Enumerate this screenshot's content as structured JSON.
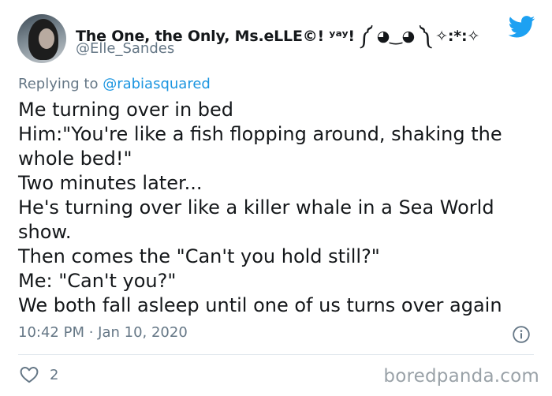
{
  "author": {
    "name": "The One, the Only, Ms.eLLE©! ʸᵃʸ! ༼ ◕‿◕ ༽ ✧:*:✧",
    "handle": "@Elle_Sandes"
  },
  "reply": {
    "prefix": "Replying to ",
    "mention": "@rabiasquared"
  },
  "body_lines": [
    "Me turning over in bed",
    "Him:\"You're like a fish flopping around, shaking the",
    "whole bed!\"",
    "Two minutes later...",
    "He's turning over like a killer whale in a Sea World",
    "show.",
    "Then comes the \"Can't you hold still?\"",
    "Me: \"Can't you?\"",
    "We both fall asleep until one of us turns over again"
  ],
  "timestamp": "10:42 PM · Jan 10, 2020",
  "likes": {
    "count": "2"
  },
  "watermark": "boredpanda.com",
  "icons": {
    "bird": "twitter-bird-icon",
    "info": "info-icon",
    "heart": "heart-icon"
  },
  "colors": {
    "brand_blue": "#1da1f2",
    "mention_blue": "#1b95e0",
    "muted_gray": "#657786",
    "text": "#14171a"
  }
}
